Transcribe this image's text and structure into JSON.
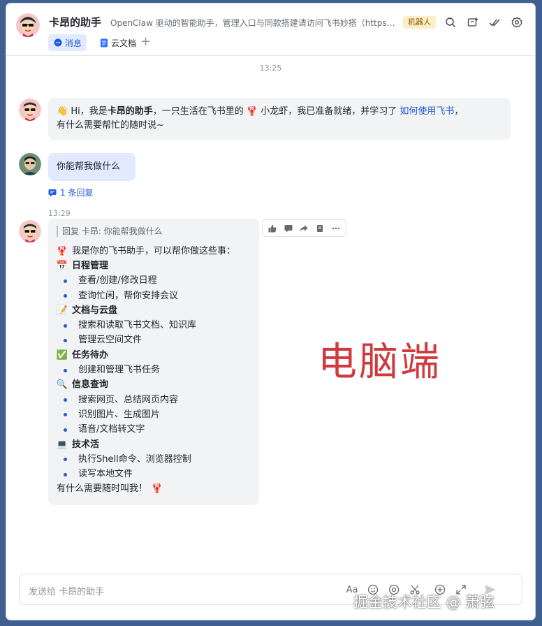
{
  "header": {
    "title": "卡昂的助手",
    "description": "OpenClaw 驱动的智能助手，管理入口与同款搭建请访问飞书妙搭（https://miaoda.feishu.cn）",
    "badge": "机器人",
    "tabs": [
      {
        "label": "消息",
        "icon": "chat-bubble-icon",
        "active": true
      },
      {
        "label": "云文档",
        "icon": "doc-icon",
        "active": false
      }
    ],
    "add_tab": "+"
  },
  "messages": {
    "time1": "13:25",
    "greeting": {
      "wave": "👋",
      "pre": " Hi，我是",
      "name": "卡昂的助手",
      "mid": "，一只生活在飞书里的 ",
      "lobster": "🦞",
      "mid2": " 小龙虾，我已准备就绪，并学习了 ",
      "link": "如何使用飞书",
      "post": "，",
      "line2": "有什么需要帮忙的随时说~"
    },
    "user_question": "你能帮我做什么",
    "reply_count": "1 条回复",
    "time2": "13:29",
    "reply": {
      "quote": "回复 卡昂: 你能帮我做什么",
      "intro_emoji": "🦞",
      "intro": "我是你的飞书助手，可以帮你做这些事：",
      "sections": [
        {
          "emoji": "📅",
          "title": "日程管理",
          "items": [
            "查看/创建/修改日程",
            "查询忙闲，帮你安排会议"
          ]
        },
        {
          "emoji": "📝",
          "title": "文档与云盘",
          "items": [
            "搜索和读取飞书文档、知识库",
            "管理云空间文件"
          ]
        },
        {
          "emoji": "✅",
          "title": "任务待办",
          "items": [
            "创建和管理飞书任务"
          ]
        },
        {
          "emoji": "🔍",
          "title": "信息查询",
          "items": [
            "搜索网页、总结网页内容",
            "识别图片、生成图片",
            "语音/文档转文字"
          ]
        },
        {
          "emoji": "💻",
          "title": "技术活",
          "items": [
            "执行Shell命令、浏览器控制",
            "读写本地文件"
          ]
        }
      ],
      "outro": "有什么需要随时叫我！",
      "outro_emoji": "🦞"
    }
  },
  "overlay_text": "电脑端",
  "input": {
    "placeholder": "发送给 卡昂的助手",
    "format_label": "Aa"
  },
  "watermark": "掘金技术社区 @ 萧弦",
  "colors": {
    "accent": "#245bdb",
    "overlay": "#d0393e"
  }
}
